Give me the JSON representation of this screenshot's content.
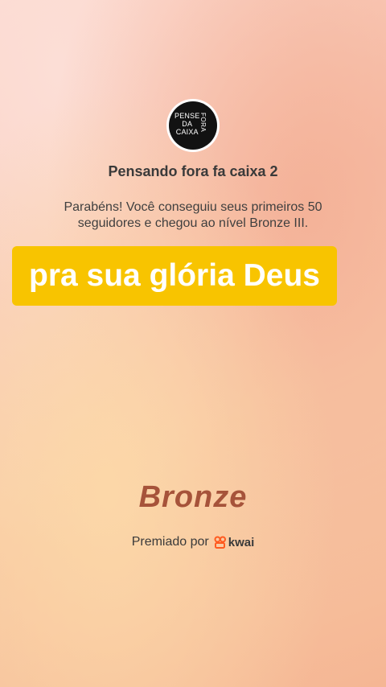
{
  "avatar": {
    "logo_lines": [
      "PENSE",
      "DA",
      "CAIXA"
    ],
    "logo_side": "FORA"
  },
  "channel_title": "Pensando fora fa caixa 2",
  "congrats_message": "Parabéns! Você conseguiu seus primeiros 50 seguidores e chegou ao nível Bronze III.",
  "highlight_text": "pra sua glória Deus",
  "level_name": "Bronze",
  "awarded_by": {
    "label": "Premiado por",
    "brand": "kwai",
    "icon": "kwai-logo-icon",
    "brand_color": "#ff5a1f"
  },
  "colors": {
    "highlight_bg": "#f8c400",
    "level_text": "#a6533a"
  }
}
